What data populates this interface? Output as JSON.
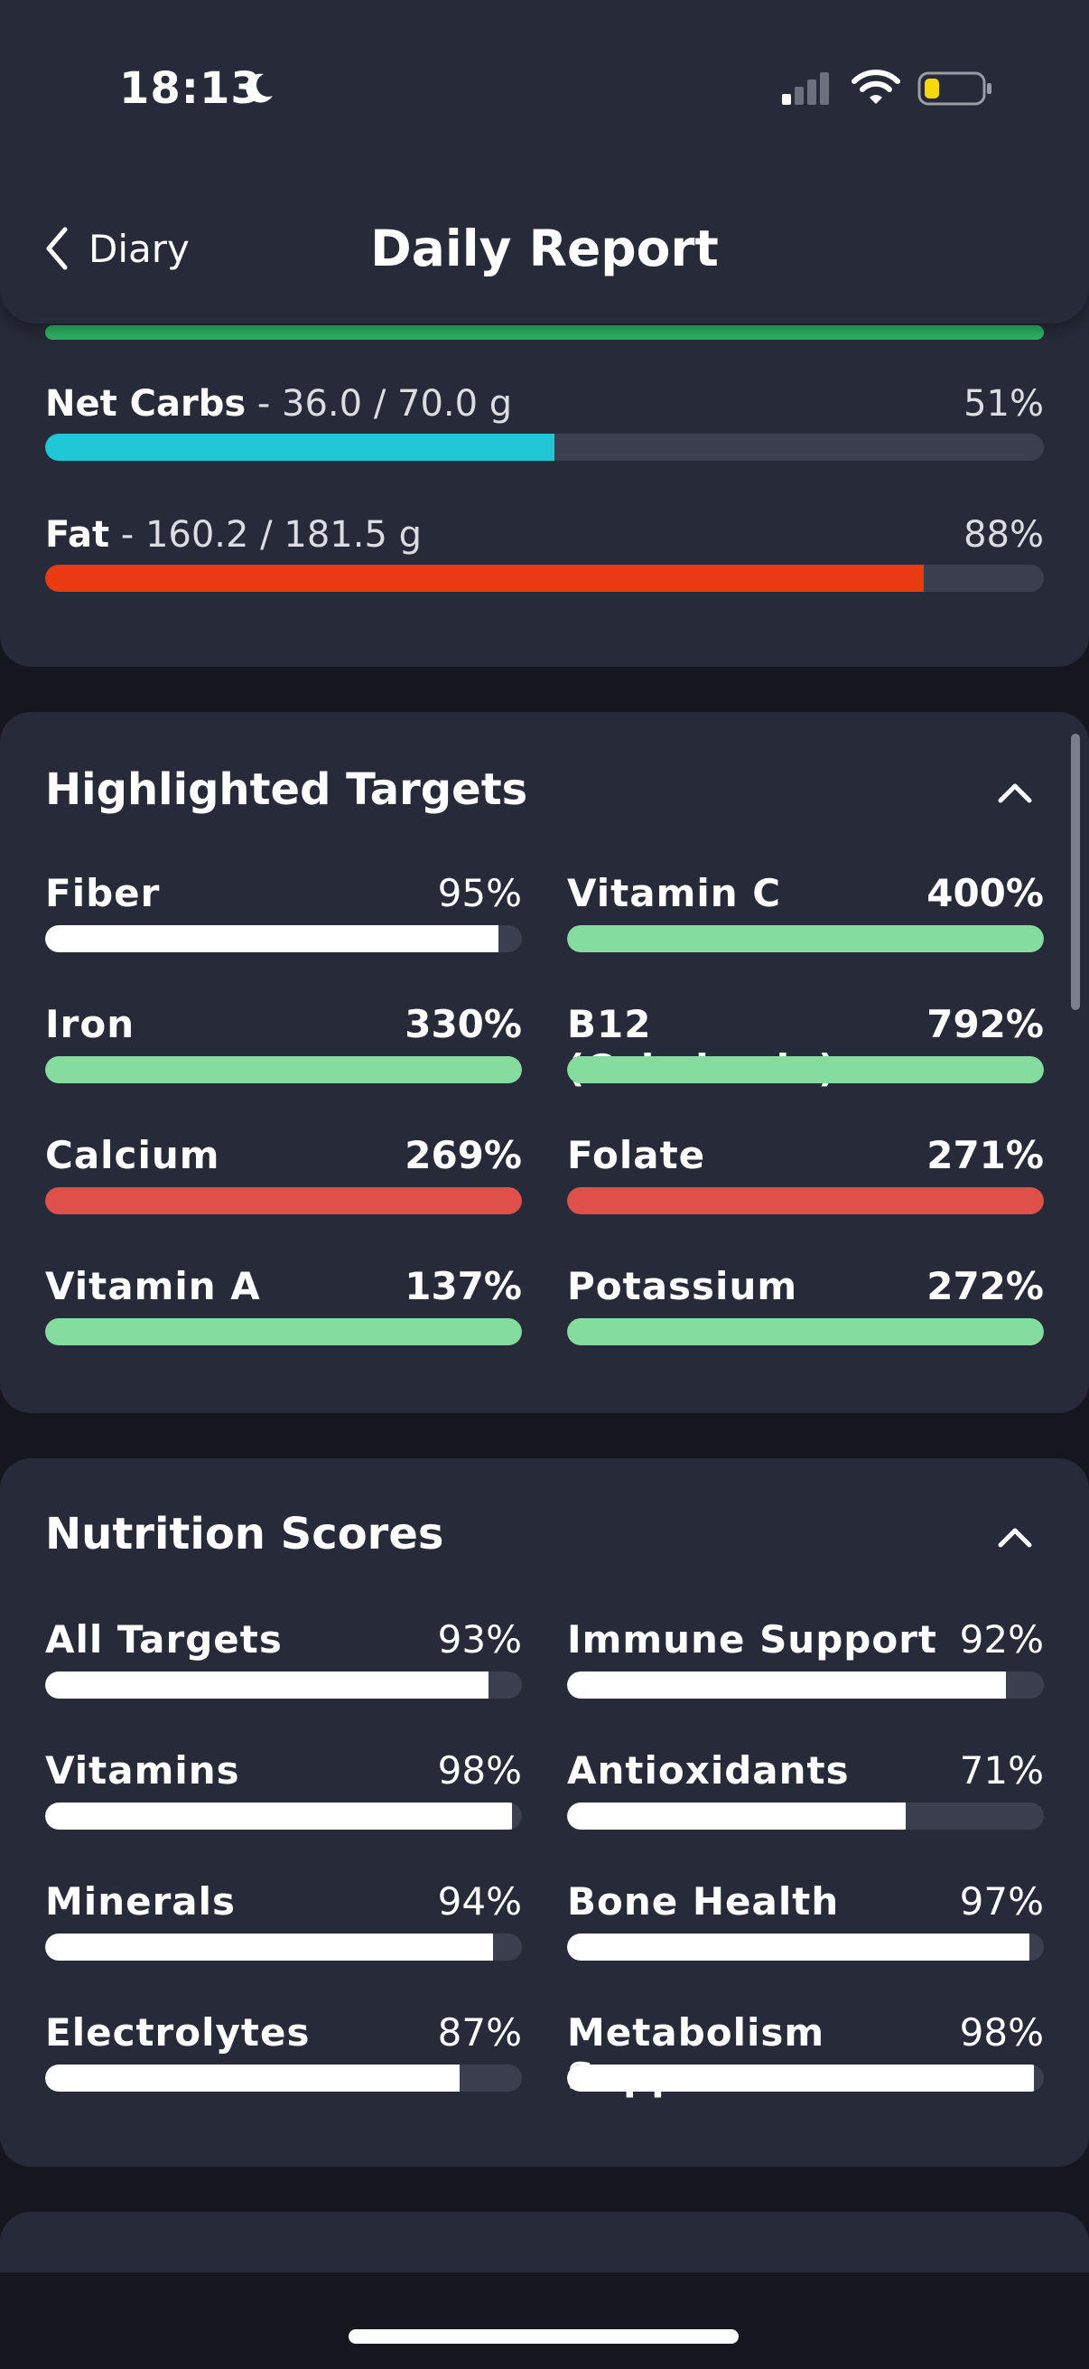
{
  "status_bar": {
    "time": "18:13"
  },
  "nav": {
    "back_label": "Diary",
    "title": "Daily Report"
  },
  "macros": [
    {
      "name": "Net Carbs",
      "amount": " - 36.0 / 70.0 g",
      "percent": "51%",
      "fill": 0.51,
      "color": "#1ec8d7"
    },
    {
      "name": "Fat",
      "amount": " - 160.2 / 181.5 g",
      "percent": "88%",
      "fill": 0.88,
      "color": "#ea3a12"
    }
  ],
  "highlighted": {
    "title": "Highlighted Targets",
    "items": [
      {
        "name": "Fiber",
        "percent": "95%",
        "fill": 0.95,
        "color": "#ffffff",
        "bold": false
      },
      {
        "name": "Vitamin C",
        "percent": "400%",
        "fill": 1.0,
        "color": "#84dd9f",
        "bold": true
      },
      {
        "name": "Iron",
        "percent": "330%",
        "fill": 1.0,
        "color": "#84dd9f",
        "bold": true
      },
      {
        "name": "B12 (Cobalamin)",
        "percent": "792%",
        "fill": 1.0,
        "color": "#84dd9f",
        "bold": true
      },
      {
        "name": "Calcium",
        "percent": "269%",
        "fill": 1.0,
        "color": "#e0504b",
        "bold": true
      },
      {
        "name": "Folate",
        "percent": "271%",
        "fill": 1.0,
        "color": "#e0504b",
        "bold": true
      },
      {
        "name": "Vitamin A",
        "percent": "137%",
        "fill": 1.0,
        "color": "#84dd9f",
        "bold": true
      },
      {
        "name": "Potassium",
        "percent": "272%",
        "fill": 1.0,
        "color": "#84dd9f",
        "bold": true
      }
    ]
  },
  "scores": {
    "title": "Nutrition Scores",
    "items": [
      {
        "name": "All Targets",
        "percent": "93%",
        "fill": 0.93,
        "color": "#ffffff",
        "bold": false
      },
      {
        "name": "Immune Support",
        "percent": "92%",
        "fill": 0.92,
        "color": "#ffffff",
        "bold": false
      },
      {
        "name": "Vitamins",
        "percent": "98%",
        "fill": 0.98,
        "color": "#ffffff",
        "bold": false
      },
      {
        "name": "Antioxidants",
        "percent": "71%",
        "fill": 0.71,
        "color": "#ffffff",
        "bold": false
      },
      {
        "name": "Minerals",
        "percent": "94%",
        "fill": 0.94,
        "color": "#ffffff",
        "bold": false
      },
      {
        "name": "Bone Health",
        "percent": "97%",
        "fill": 0.97,
        "color": "#ffffff",
        "bold": false
      },
      {
        "name": "Electrolytes",
        "percent": "87%",
        "fill": 0.87,
        "color": "#ffffff",
        "bold": false
      },
      {
        "name": "Metabolism Supp…",
        "percent": "98%",
        "fill": 0.98,
        "color": "#ffffff",
        "bold": false
      }
    ]
  },
  "colors": {
    "background": "#15161e",
    "card": "#272a38",
    "track": "#3c3f4f",
    "protein_bar": "#2db464"
  },
  "icons": [
    "moon-icon",
    "signal-icon",
    "wifi-icon",
    "battery-icon",
    "chevron-left-icon",
    "chevron-up-icon"
  ]
}
